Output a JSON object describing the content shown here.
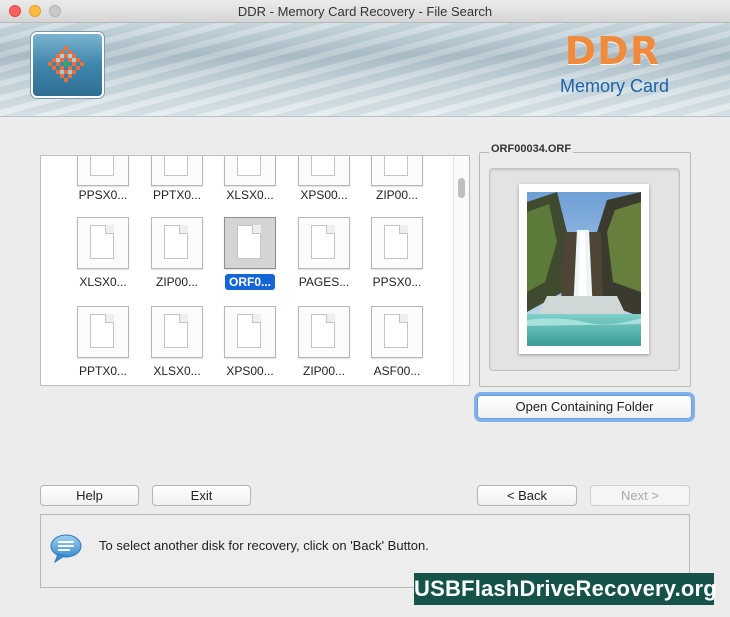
{
  "window": {
    "title": "DDR - Memory Card Recovery - File Search"
  },
  "banner": {
    "brand": "DDR",
    "product": "Memory Card"
  },
  "thumbnails": {
    "rows": [
      [
        "PPSX0...",
        "PPTX0...",
        "XLSX0...",
        "XPS00...",
        "ZIP00..."
      ],
      [
        "XLSX0...",
        "ZIP00...",
        "ORF0...",
        "PAGES...",
        "PPSX0..."
      ],
      [
        "PPTX0...",
        "XLSX0...",
        "XPS00...",
        "ZIP00...",
        "ASF00..."
      ]
    ],
    "selected": "ORF0..."
  },
  "preview": {
    "filename": "ORF00034.ORF",
    "open_folder_label": "Open Containing Folder"
  },
  "buttons": {
    "help": "Help",
    "exit": "Exit",
    "back": "< Back",
    "next": "Next >"
  },
  "message": {
    "text": "To select another disk for recovery, click on 'Back' Button."
  },
  "watermark": "USBFlashDriveRecovery.org",
  "colors": {
    "brand_orange": "#f08a3c",
    "brand_blue": "#1d63a8",
    "selection": "#1565d6",
    "watermark_bg": "#14524a"
  }
}
